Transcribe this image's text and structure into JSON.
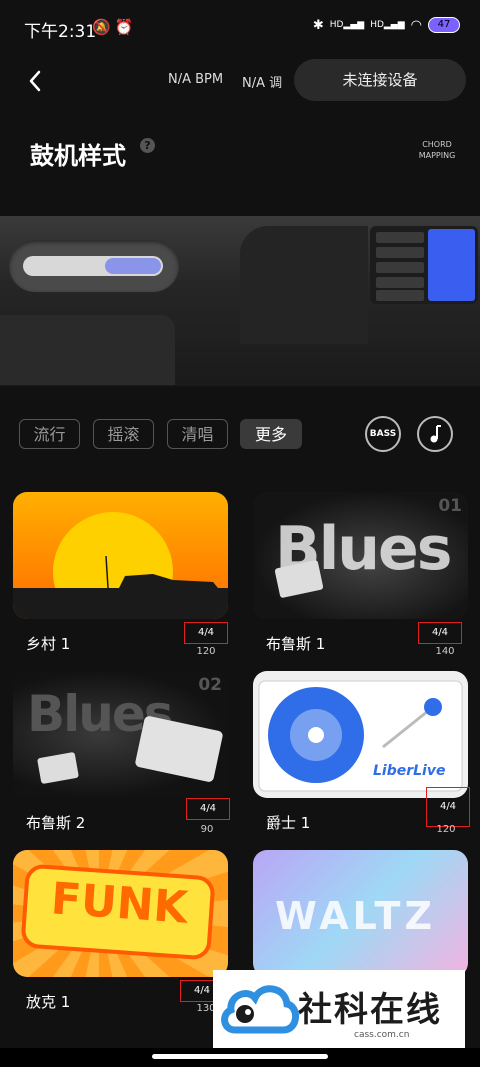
{
  "status": {
    "time": "下午2:31",
    "icons": [
      "mute-icon",
      "alarm-icon"
    ],
    "right_icons": [
      "bluetooth-icon",
      "signal-icon",
      "signal-icon",
      "wifi-icon"
    ],
    "hd1": "HD",
    "hd2": "HD",
    "battery": "47"
  },
  "header": {
    "bpm": "N/A BPM",
    "key": "N/A 调",
    "device_button": "未连接设备",
    "title": "鼓机样式",
    "help": "?",
    "chord_mapping": "CHORD MAPPING"
  },
  "device": {
    "fader_level": 0.4
  },
  "tabs": [
    {
      "label": "流行",
      "active": false
    },
    {
      "label": "摇滚",
      "active": false
    },
    {
      "label": "清唱",
      "active": false
    },
    {
      "label": "更多",
      "active": true
    }
  ],
  "bass_button": "BASS",
  "cards": [
    {
      "name": "乡村 1",
      "time_sig": "4/4",
      "bpm": "120",
      "art": "sunset"
    },
    {
      "name": "布鲁斯 1",
      "time_sig": "4/4",
      "bpm": "140",
      "art_label": "01"
    },
    {
      "name": "布鲁斯 2",
      "time_sig": "4/4",
      "bpm": "90",
      "art_label": "02"
    },
    {
      "name": "爵士 1",
      "time_sig": "4/4",
      "bpm": "120",
      "art_brand": "LiberLive"
    },
    {
      "name": "放克 1",
      "time_sig": "4/4",
      "bpm": "130",
      "art_text": "FUNK"
    },
    {
      "name": "",
      "time_sig": "",
      "bpm": "",
      "art_text": "WALTZ"
    }
  ],
  "art_text_blues": "Blues",
  "watermark": {
    "text": "社科在线",
    "url": "cass.com.cn"
  },
  "colors": {
    "accent": "#3a5ef0",
    "fader": "#8a94e8",
    "highlight_box": "#e02020"
  }
}
